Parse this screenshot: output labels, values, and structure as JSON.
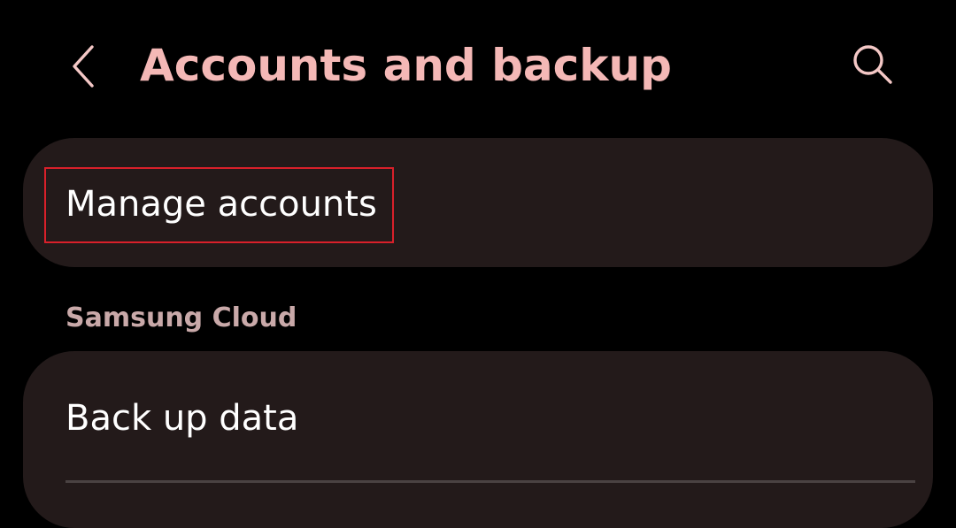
{
  "header": {
    "back_icon": "chevron-left-icon",
    "title": "Accounts and backup",
    "search_icon": "search-icon"
  },
  "items": {
    "manage_accounts": "Manage accounts"
  },
  "samsung_cloud": {
    "section_title": "Samsung Cloud",
    "back_up_data": "Back up data"
  },
  "colors": {
    "background": "#000000",
    "card": "#231a1a",
    "title_accent": "#f4b8b6",
    "icon": "#f4c8c6",
    "section_header": "#c9a9a9",
    "primary_text": "#ffffff",
    "highlight": "#d8202a"
  }
}
